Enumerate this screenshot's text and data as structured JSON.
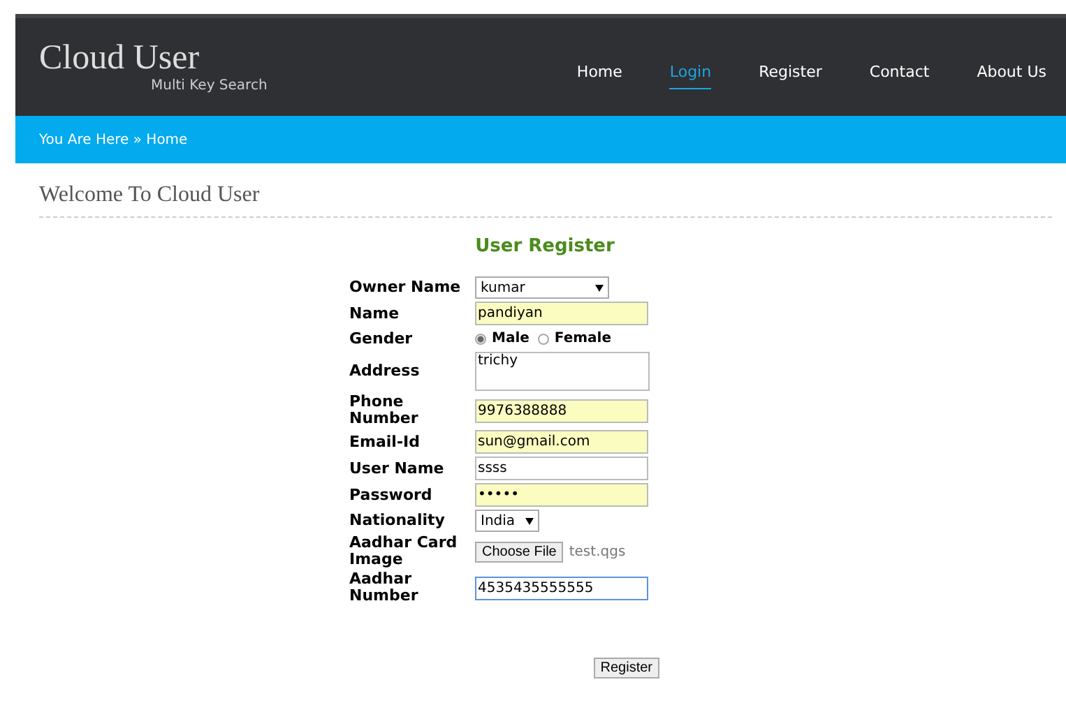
{
  "header": {
    "title": "Cloud User",
    "subtitle": "Multi Key Search"
  },
  "nav": [
    {
      "label": "Home",
      "selected": false
    },
    {
      "label": "Login",
      "selected": true
    },
    {
      "label": "Register",
      "selected": false
    },
    {
      "label": "Contact",
      "selected": false
    },
    {
      "label": "About Us",
      "selected": false
    }
  ],
  "breadcrumb": "You Are Here » Home",
  "page_title": "Welcome To Cloud User",
  "form": {
    "title": "User Register",
    "fields": [
      {
        "label": "Owner Name",
        "kind": "select",
        "value": "kumar"
      },
      {
        "label": "Name",
        "kind": "text",
        "value": "pandiyan",
        "autofilled": true,
        "focused": false
      },
      {
        "label": "Gender",
        "kind": "radio",
        "options": [
          {
            "label": "Male",
            "selected": true
          },
          {
            "label": "Female",
            "selected": false
          }
        ]
      },
      {
        "label": "Address",
        "kind": "textarea",
        "value": "trichy",
        "autofilled": false,
        "focused": false
      },
      {
        "label": "Phone Number",
        "kind": "text",
        "value": "9976388888",
        "autofilled": true,
        "focused": false
      },
      {
        "label": "Email-Id",
        "kind": "text",
        "value": "sun@gmail.com",
        "autofilled": true,
        "focused": false
      },
      {
        "label": "User Name",
        "kind": "text",
        "value": "ssss",
        "autofilled": false,
        "focused": false
      },
      {
        "label": "Password",
        "kind": "text",
        "value": "•••••",
        "autofilled": true,
        "focused": false
      },
      {
        "label": "Nationality",
        "kind": "smallselect",
        "value": "India"
      },
      {
        "label": "Aadhar Card Image",
        "kind": "file",
        "button": "Choose File",
        "value": "test.qgs"
      },
      {
        "label": "Aadhar Number",
        "kind": "text",
        "value": "4535435555555",
        "autofilled": false,
        "focused": true
      }
    ],
    "submit": "Register"
  }
}
